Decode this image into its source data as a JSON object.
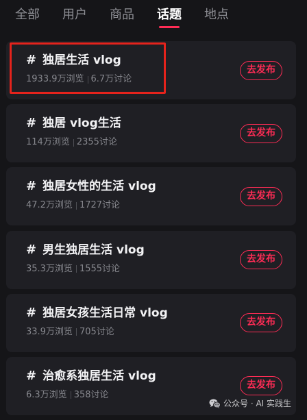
{
  "tabs": [
    {
      "label": "全部",
      "active": false
    },
    {
      "label": "用户",
      "active": false
    },
    {
      "label": "商品",
      "active": false
    },
    {
      "label": "话题",
      "active": true
    },
    {
      "label": "地点",
      "active": false
    }
  ],
  "topic_prefix": "#",
  "topics": [
    {
      "title": "独居生活 vlog",
      "views": "1933.9万浏览",
      "discussions": "6.7万讨论",
      "action_label": "去发布",
      "highlighted": true
    },
    {
      "title": "独居 vlog生活",
      "views": "114万浏览",
      "discussions": "2355讨论",
      "action_label": "去发布",
      "highlighted": false
    },
    {
      "title": "独居女性的生活 vlog",
      "views": "47.2万浏览",
      "discussions": "1727讨论",
      "action_label": "去发布",
      "highlighted": false
    },
    {
      "title": "男生独居生活 vlog",
      "views": "35.3万浏览",
      "discussions": "1555讨论",
      "action_label": "去发布",
      "highlighted": false
    },
    {
      "title": "独居女孩生活日常 vlog",
      "views": "33.9万浏览",
      "discussions": "705讨论",
      "action_label": "去发布",
      "highlighted": false
    },
    {
      "title": "治愈系独居生活 vlog",
      "views": "6.3万浏览",
      "discussions": "358讨论",
      "action_label": "去发布",
      "highlighted": false
    }
  ],
  "watermark": {
    "icon": "wechat-icon",
    "text": "公众号 · AI 实践生"
  },
  "colors": {
    "background": "#151518",
    "card": "#1f1f24",
    "accent": "#fe2c55",
    "annotation": "#e5231c",
    "title": "#f2f2f4",
    "muted": "#86878d"
  }
}
